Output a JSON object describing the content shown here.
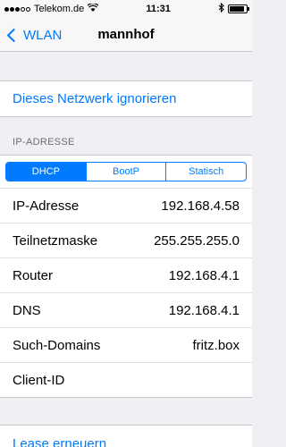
{
  "status": {
    "carrier": "Telekom.de",
    "time": "11:31"
  },
  "nav": {
    "back_label": "WLAN",
    "title": "mannhof"
  },
  "ignore_network": "Dieses Netzwerk ignorieren",
  "ip_section": {
    "header": "IP-ADRESSE",
    "tabs": [
      "DHCP",
      "BootP",
      "Statisch"
    ],
    "selected_tab": "DHCP"
  },
  "rows": [
    {
      "label": "IP-Adresse",
      "value": "192.168.4.58"
    },
    {
      "label": "Teilnetzmaske",
      "value": "255.255.255.0"
    },
    {
      "label": "Router",
      "value": "192.168.4.1"
    },
    {
      "label": "DNS",
      "value": "192.168.4.1"
    },
    {
      "label": "Such-Domains",
      "value": "fritz.box"
    },
    {
      "label": "Client-ID",
      "value": ""
    }
  ],
  "lease_renew": "Lease erneuern",
  "colors": {
    "accent": "#007aff",
    "background": "#efeff4"
  }
}
